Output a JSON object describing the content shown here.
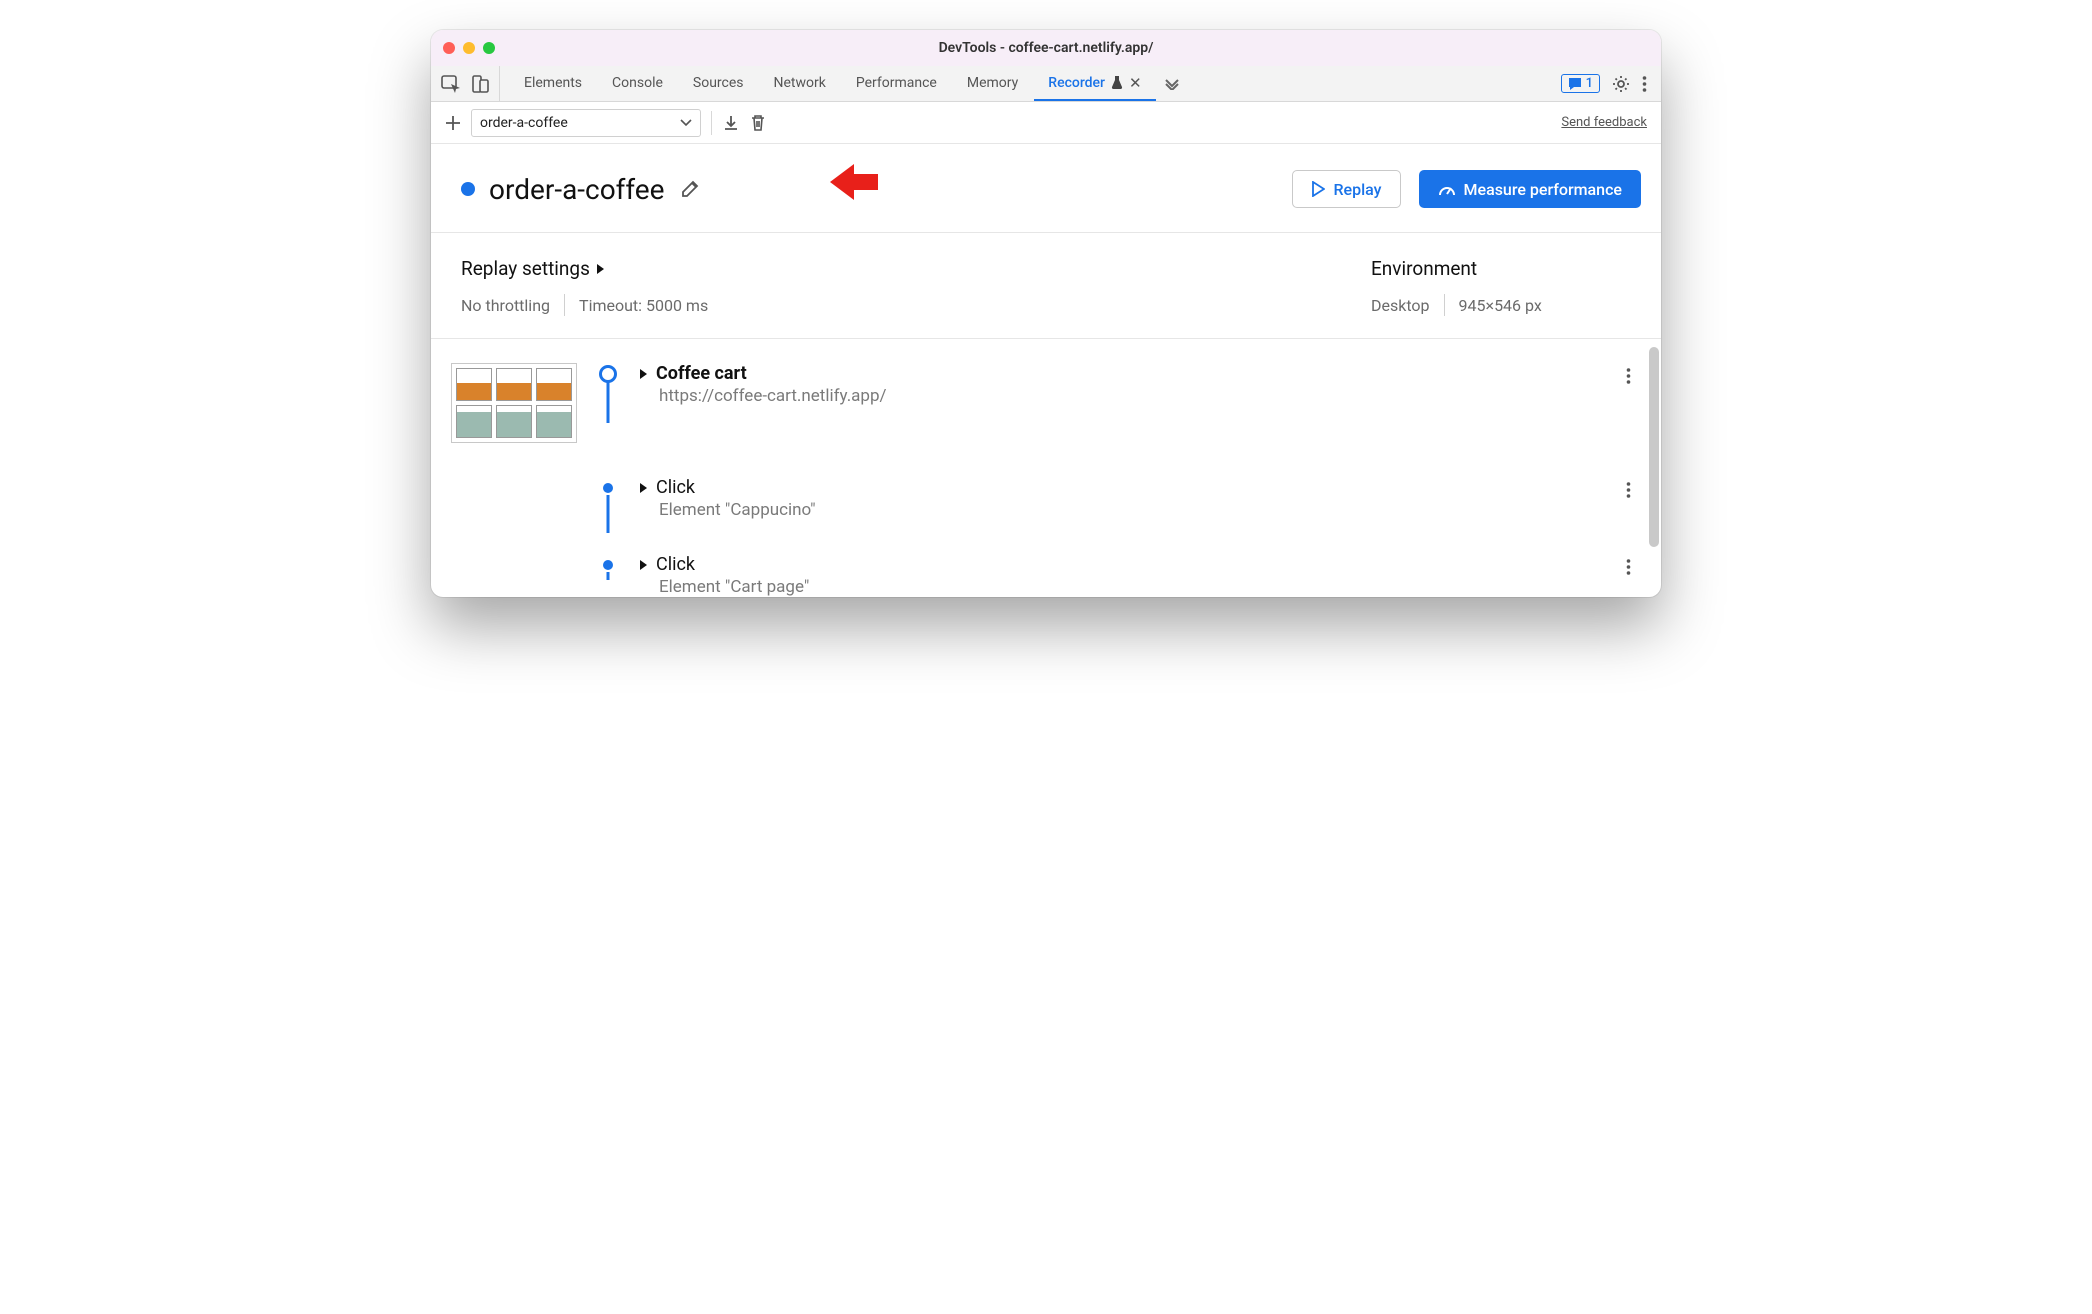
{
  "window": {
    "title": "DevTools - coffee-cart.netlify.app/"
  },
  "tabs": {
    "items": [
      "Elements",
      "Console",
      "Sources",
      "Network",
      "Performance",
      "Memory",
      "Recorder"
    ],
    "active": "Recorder",
    "issues_badge": "1"
  },
  "toolbar": {
    "recording_name": "order-a-coffee",
    "send_feedback": "Send feedback"
  },
  "recorder": {
    "title": "order-a-coffee",
    "replay_label": "Replay",
    "measure_label": "Measure performance"
  },
  "replay_settings": {
    "heading": "Replay settings",
    "throttling": "No throttling",
    "timeout_label": "Timeout: 5000 ms"
  },
  "environment": {
    "heading": "Environment",
    "device": "Desktop",
    "viewport": "945×546 px"
  },
  "steps": [
    {
      "title": "Coffee cart",
      "subtitle": "https://coffee-cart.netlify.app/",
      "bold": true,
      "has_thumb": true,
      "marker": "circle"
    },
    {
      "title": "Click",
      "subtitle": "Element \"Cappucino\"",
      "bold": false,
      "has_thumb": false,
      "marker": "dot"
    },
    {
      "title": "Click",
      "subtitle": "Element \"Cart page\"",
      "bold": false,
      "has_thumb": false,
      "marker": "dot"
    }
  ]
}
